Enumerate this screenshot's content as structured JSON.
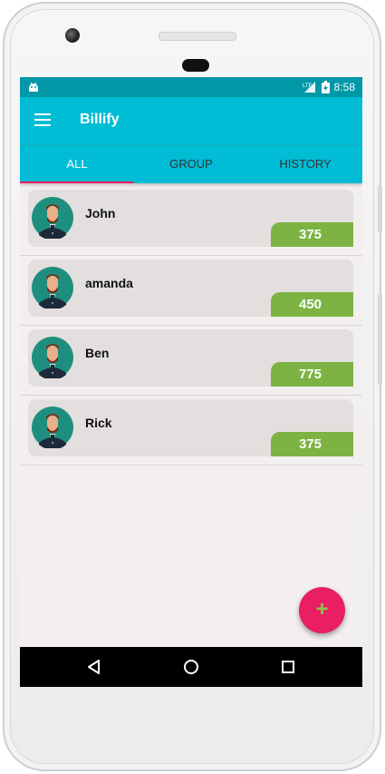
{
  "status_bar": {
    "time": "8:58",
    "left_icon": "android-notification-icon",
    "network_icon": "lte-signal-icon",
    "battery_icon": "battery-charging-icon"
  },
  "app_bar": {
    "title": "Billify",
    "menu_icon": "hamburger-menu-icon"
  },
  "tabs": [
    {
      "label": "ALL",
      "active": true
    },
    {
      "label": "GROUP",
      "active": false
    },
    {
      "label": "HISTORY",
      "active": false
    }
  ],
  "people": [
    {
      "name": "John",
      "amount": "375"
    },
    {
      "name": "amanda",
      "amount": "450"
    },
    {
      "name": "Ben",
      "amount": "775"
    },
    {
      "name": "Rick",
      "amount": "375"
    }
  ],
  "fab": {
    "label": "+",
    "icon": "add-icon"
  },
  "nav_bar": {
    "back_icon": "back-triangle-icon",
    "home_icon": "home-circle-icon",
    "recents_icon": "recents-square-icon"
  },
  "colors": {
    "primary": "#00bcd4",
    "primary_dark": "#0097a7",
    "accent": "#e91e63",
    "amount_badge": "#7cb342"
  }
}
